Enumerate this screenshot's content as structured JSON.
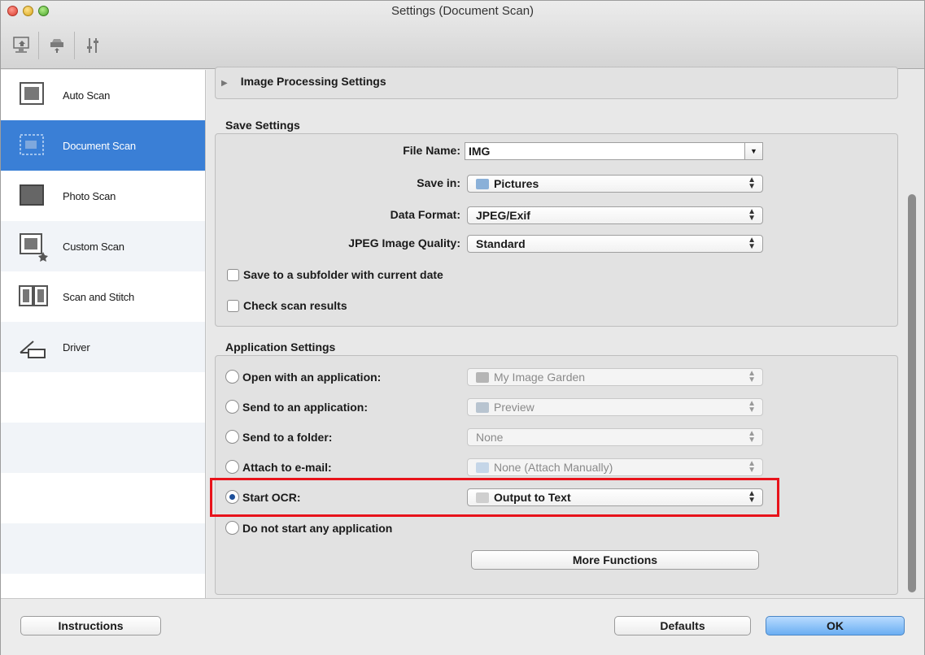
{
  "window": {
    "title": "Settings (Document Scan)"
  },
  "toolbar": {
    "buttons": [
      {
        "icon": "scan-from-computer-icon"
      },
      {
        "icon": "scan-from-panel-icon"
      },
      {
        "icon": "general-settings-icon"
      }
    ]
  },
  "sidebar": {
    "items": [
      {
        "label": "Auto Scan",
        "icon": "auto-scan-icon"
      },
      {
        "label": "Document Scan",
        "icon": "document-scan-icon",
        "selected": true
      },
      {
        "label": "Photo Scan",
        "icon": "photo-scan-icon"
      },
      {
        "label": "Custom Scan",
        "icon": "custom-scan-icon"
      },
      {
        "label": "Scan and Stitch",
        "icon": "scan-and-stitch-icon"
      },
      {
        "label": "Driver",
        "icon": "driver-icon"
      }
    ]
  },
  "image_processing": {
    "label": "Image Processing Settings"
  },
  "save_settings": {
    "title": "Save Settings",
    "file_name_label": "File Name:",
    "file_name_value": "IMG",
    "save_in_label": "Save in:",
    "save_in_value": "Pictures",
    "data_format_label": "Data Format:",
    "data_format_value": "JPEG/Exif",
    "jpeg_quality_label": "JPEG Image Quality:",
    "jpeg_quality_value": "Standard",
    "subfolder_label": "Save to a subfolder with current date",
    "check_results_label": "Check scan results"
  },
  "application_settings": {
    "title": "Application Settings",
    "options": [
      {
        "label": "Open with an application:",
        "value": "My Image Garden",
        "selected": false,
        "enabled": false
      },
      {
        "label": "Send to an application:",
        "value": "Preview",
        "selected": false,
        "enabled": false
      },
      {
        "label": "Send to a folder:",
        "value": "None",
        "selected": false,
        "enabled": false
      },
      {
        "label": "Attach to e-mail:",
        "value": "None (Attach Manually)",
        "selected": false,
        "enabled": false
      },
      {
        "label": "Start OCR:",
        "value": "Output to Text",
        "selected": true,
        "enabled": true
      },
      {
        "label": "Do not start any application",
        "selected": false
      }
    ],
    "more_functions_label": "More Functions"
  },
  "footer": {
    "instructions_label": "Instructions",
    "defaults_label": "Defaults",
    "ok_label": "OK"
  },
  "colors": {
    "selection": "#3a7fd6",
    "highlight": "#e8131b",
    "ok_button": "#6aaef2"
  }
}
